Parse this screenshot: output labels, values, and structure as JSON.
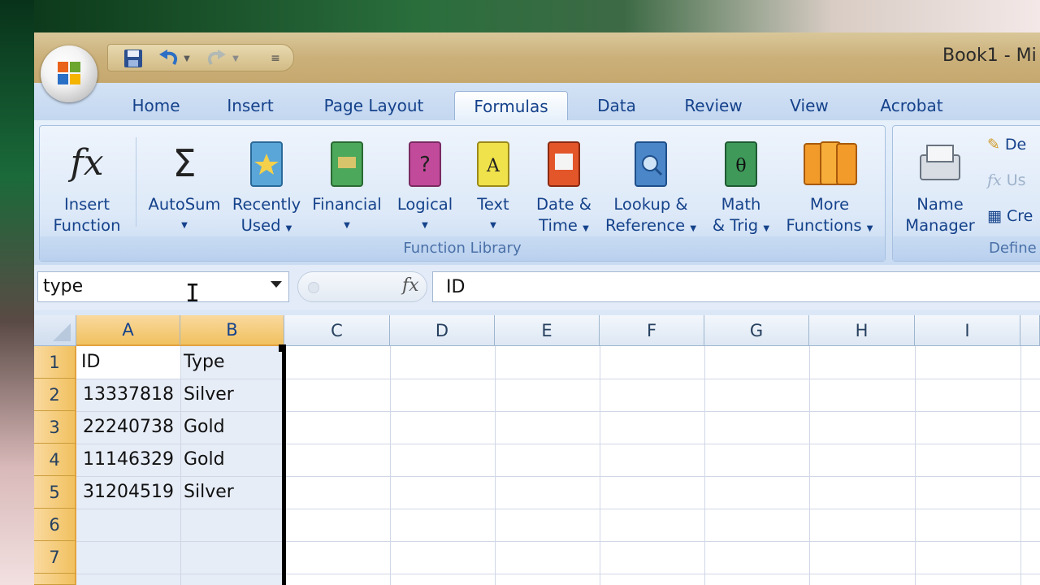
{
  "window": {
    "title": "Book1 - Mi"
  },
  "tabs": [
    "Home",
    "Insert",
    "Page Layout",
    "Formulas",
    "Data",
    "Review",
    "View",
    "Acrobat"
  ],
  "active_tab": "Formulas",
  "ribbon": {
    "function_library": {
      "label": "Function Library",
      "insert_function": [
        "Insert",
        "Function"
      ],
      "autosum": "AutoSum",
      "recently_used": [
        "Recently",
        "Used"
      ],
      "financial": "Financial",
      "logical": "Logical",
      "text": "Text",
      "date_time": [
        "Date &",
        "Time"
      ],
      "lookup_reference": [
        "Lookup &",
        "Reference"
      ],
      "math_trig": [
        "Math",
        "& Trig"
      ],
      "more_functions": [
        "More",
        "Functions"
      ]
    },
    "defined_names": {
      "label": "Define",
      "name_manager": [
        "Name",
        "Manager"
      ],
      "define_name": "De",
      "use_in_formula": "Us",
      "create_from_selection": "Cre"
    }
  },
  "formula_bar": {
    "name_box": "type",
    "fx_label": "fx",
    "formula": "ID"
  },
  "sheet": {
    "columns": [
      "A",
      "B",
      "C",
      "D",
      "E",
      "F",
      "G",
      "H",
      "I"
    ],
    "rows": [
      "1",
      "2",
      "3",
      "4",
      "5",
      "6",
      "7"
    ],
    "cells": [
      [
        "ID",
        "Type"
      ],
      [
        "13337818",
        "Silver"
      ],
      [
        "22240738",
        "Gold"
      ],
      [
        "11146329",
        "Gold"
      ],
      [
        "31204519",
        "Silver"
      ],
      [
        "",
        ""
      ],
      [
        "",
        ""
      ]
    ],
    "selected_range": "A1:B7+"
  },
  "colors": {
    "ribbon_text": "#15428b",
    "header_selected": "#f1c15f",
    "title_bar": "#cbb07a"
  }
}
